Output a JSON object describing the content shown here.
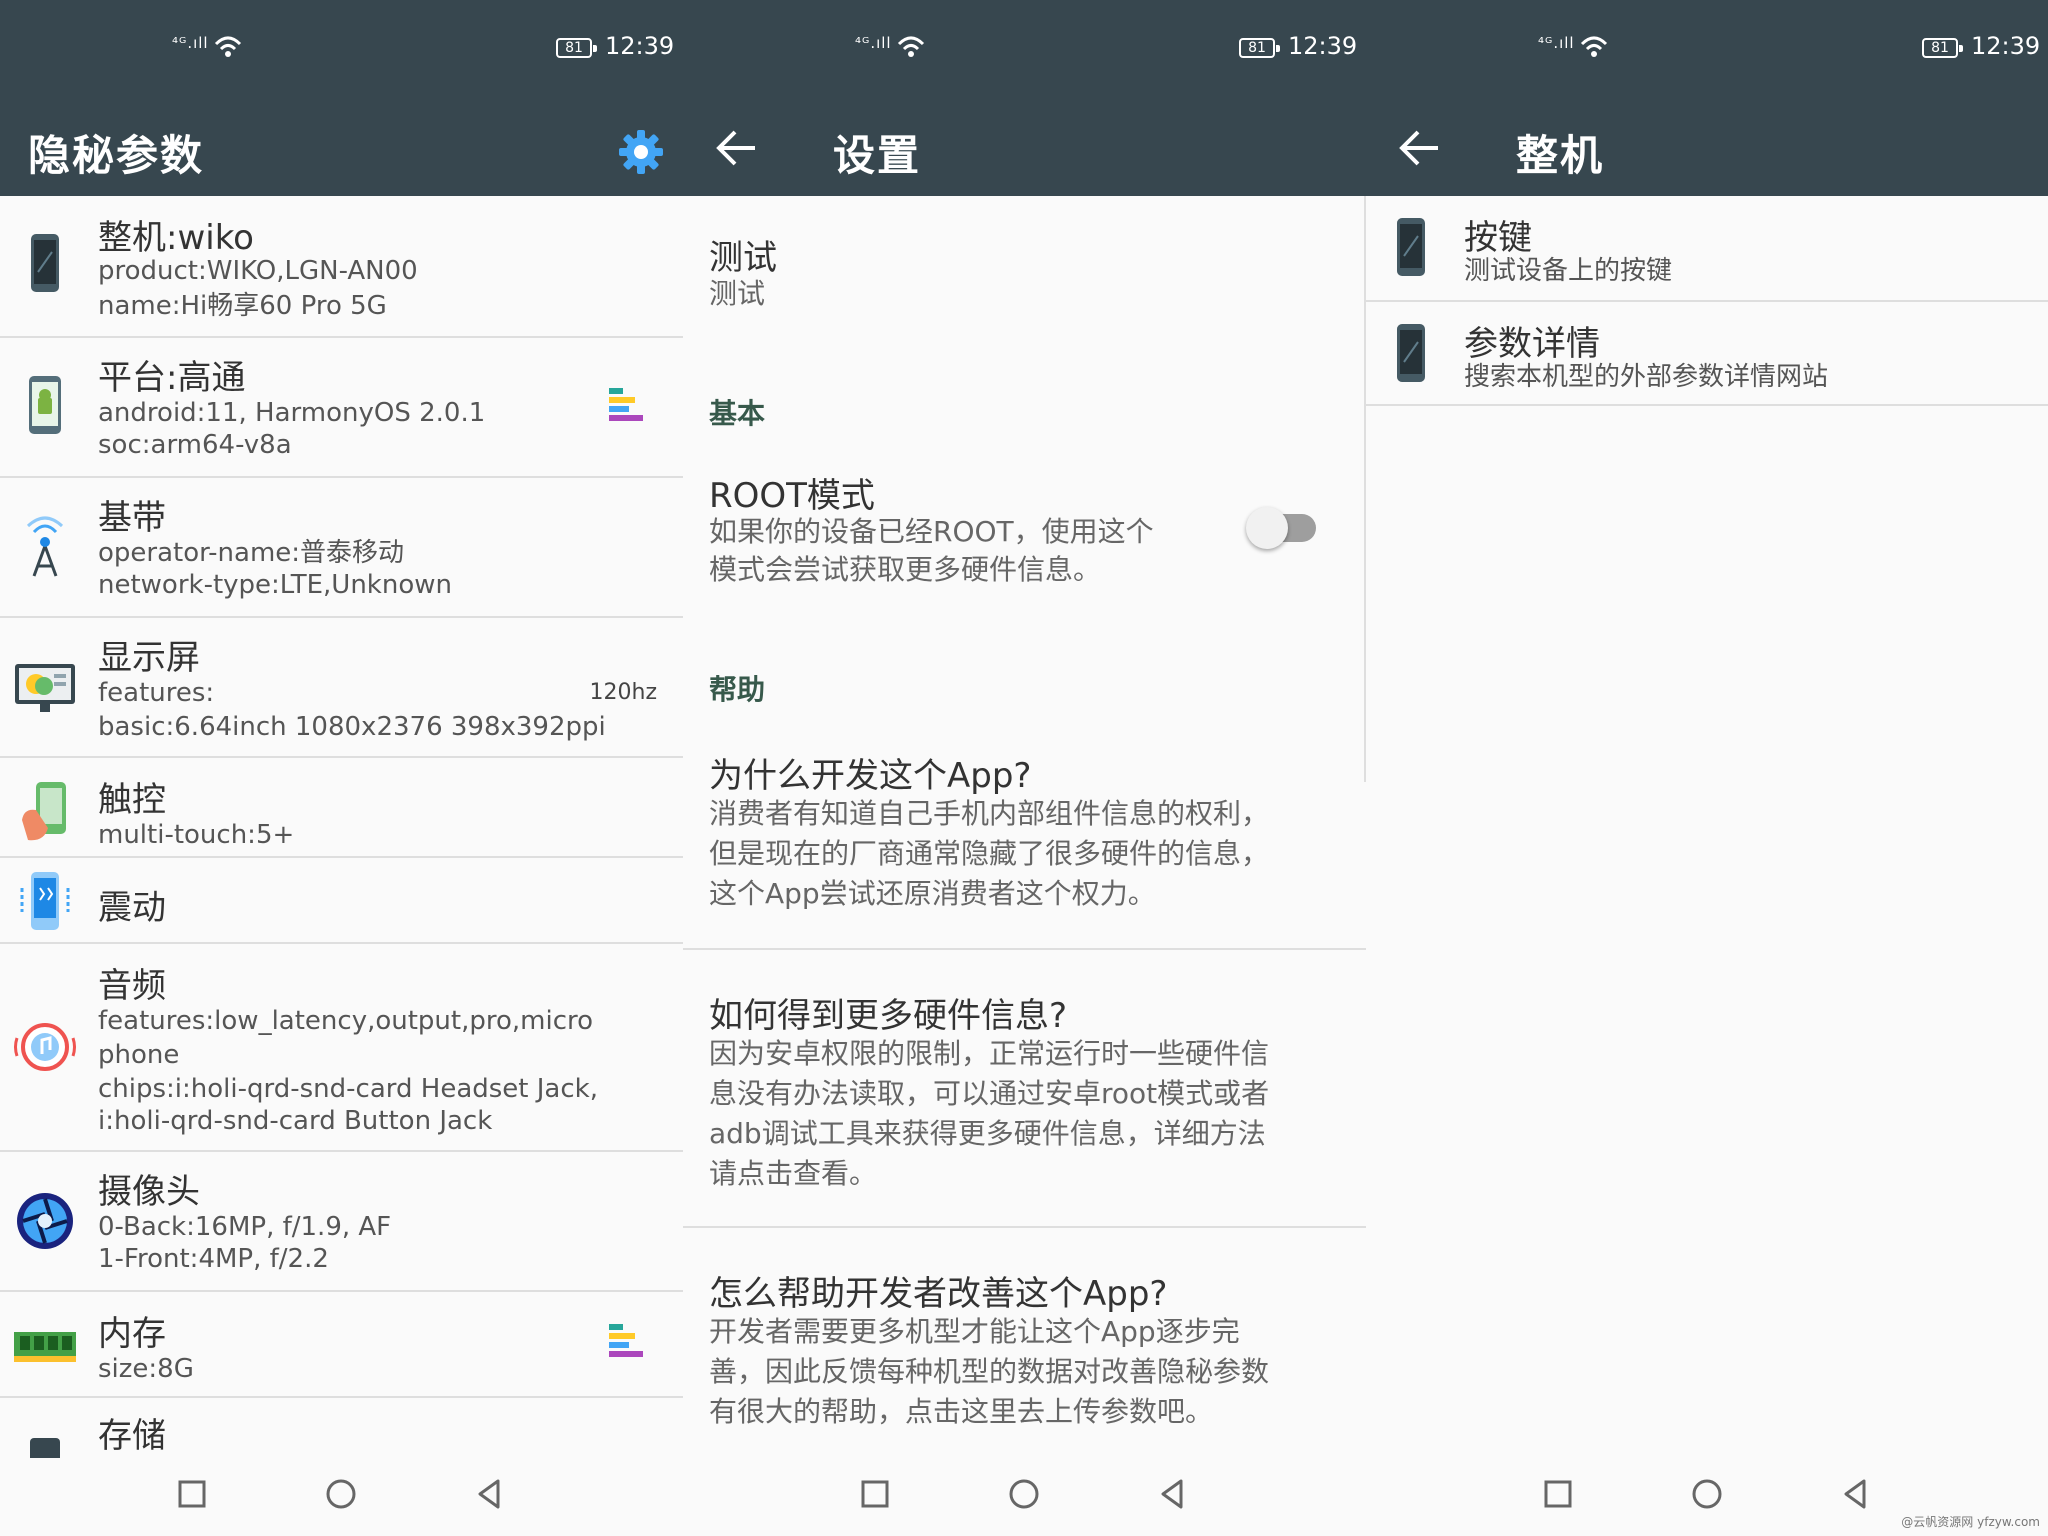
{
  "status": {
    "network": "⁴ᴳ.ıll",
    "wifi": "wifi-icon",
    "battery": "81",
    "time": "12:39"
  },
  "panel1": {
    "title": "隐秘参数",
    "items": [
      {
        "title": "整机:wiko",
        "lines": [
          "product:WIKO,LGN-AN00",
          "name:Hi畅享60 Pro 5G"
        ],
        "icon": "phone-icon"
      },
      {
        "title": "平台:高通",
        "lines": [
          "android:11, HarmonyOS 2.0.1",
          "soc:arm64-v8a"
        ],
        "icon": "android-icon",
        "bars": true
      },
      {
        "title": "基带",
        "lines": [
          "operator-name:普泰移动",
          "network-type:LTE,Unknown"
        ],
        "icon": "antenna-icon"
      },
      {
        "title": "显示屏",
        "lines": [
          "features:",
          "basic:6.64inch 1080x2376 398x392ppi"
        ],
        "icon": "monitor-icon",
        "right": "120hz"
      },
      {
        "title": "触控",
        "lines": [
          "multi-touch:5+"
        ],
        "icon": "touch-icon"
      },
      {
        "title": "震动",
        "lines": [],
        "icon": "vibration-icon"
      },
      {
        "title": "音频",
        "lines": [
          "features:low_latency,output,pro,micro",
          "phone",
          "chips:i:holi-qrd-snd-card Headset Jack,",
          "i:holi-qrd-snd-card Button Jack"
        ],
        "icon": "audio-icon"
      },
      {
        "title": "摄像头",
        "lines": [
          "0-Back:16MP, f/1.9, AF",
          "1-Front:4MP, f/2.2"
        ],
        "icon": "camera-icon"
      },
      {
        "title": "内存",
        "lines": [
          "size:8G"
        ],
        "icon": "memory-icon",
        "bars": true
      },
      {
        "title": "存储",
        "lines": [],
        "icon": "storage-icon"
      }
    ]
  },
  "panel2": {
    "title": "设置",
    "test_title": "测试",
    "test_sub": "测试",
    "section_basic": "基本",
    "root_title": "ROOT模式",
    "root_desc": [
      "如果你的设备已经ROOT，使用这个",
      "模式会尝试获取更多硬件信息。"
    ],
    "section_help": "帮助",
    "help_items": [
      {
        "title": "为什么开发这个App?",
        "lines": [
          "消费者有知道自己手机内部组件信息的权利，",
          "但是现在的厂商通常隐藏了很多硬件的信息，",
          "这个App尝试还原消费者这个权力。"
        ]
      },
      {
        "title": "如何得到更多硬件信息?",
        "lines": [
          "因为安卓权限的限制，正常运行时一些硬件信",
          "息没有办法读取，可以通过安卓root模式或者",
          "adb调试工具来获得更多硬件信息，详细方法",
          "请点击查看。"
        ]
      },
      {
        "title": "怎么帮助开发者改善这个App?",
        "lines": [
          "开发者需要更多机型才能让这个App逐步完",
          "善，因此反馈每种机型的数据对改善隐秘参数",
          "有很大的帮助，点击这里去上传参数吧。"
        ]
      }
    ]
  },
  "panel3": {
    "title": "整机",
    "items": [
      {
        "title": "按键",
        "sub": "测试设备上的按键"
      },
      {
        "title": "参数详情",
        "sub": "搜索本机型的外部参数详情网站"
      }
    ]
  },
  "watermark": "@云帆资源网 yfzyw.com",
  "colors": {
    "bar": "#37474f",
    "accent": "#37594b",
    "gear": "#42a5f5"
  }
}
